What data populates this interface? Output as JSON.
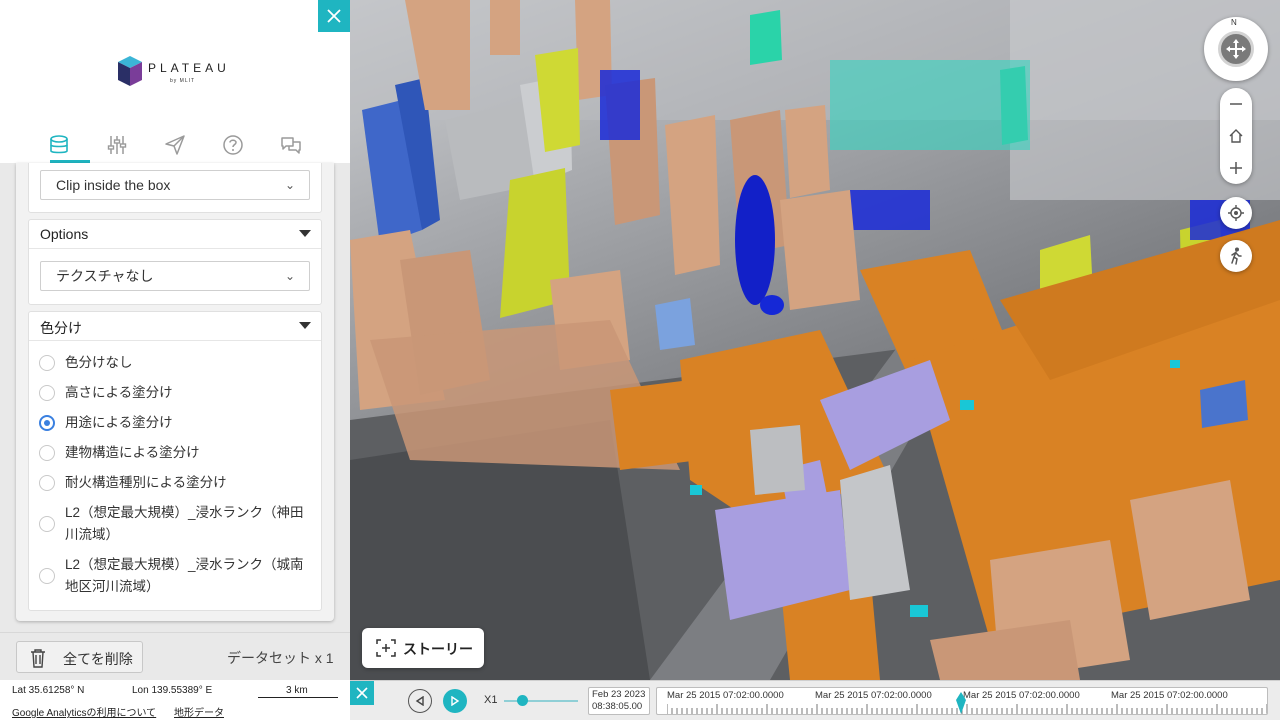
{
  "panel": {
    "logo_word": "PLATEAU",
    "logo_sub": "by MLIT",
    "tabs": [
      {
        "icon": "database-icon"
      },
      {
        "icon": "sliders-icon"
      },
      {
        "icon": "paper-plane-icon"
      },
      {
        "icon": "help-circle-icon"
      },
      {
        "icon": "chat-bubbles-icon"
      }
    ],
    "clip_select_value": "Clip inside the box",
    "options_title": "Options",
    "texture_select_value": "テクスチャなし",
    "color_title": "色分け",
    "color_options": [
      {
        "label": "色分けなし",
        "selected": false
      },
      {
        "label": "高さによる塗分け",
        "selected": false
      },
      {
        "label": "用途による塗分け",
        "selected": true
      },
      {
        "label": "建物構造による塗分け",
        "selected": false
      },
      {
        "label": "耐火構造種別による塗分け",
        "selected": false
      },
      {
        "label": "L2（想定最大規模）_浸水ランク（神田川流域）",
        "selected": false
      },
      {
        "label": "L2（想定最大規模）_浸水ランク（城南地区河川流域）",
        "selected": false
      }
    ],
    "delete_all_label": "全てを削除",
    "dataset_count": "データセット x 1"
  },
  "status": {
    "lat": "Lat  35.61258° N",
    "lon": "Lon  139.55389° E",
    "scale": "3 km",
    "analytics_link": "Google Analyticsの利用について",
    "terrain_link": "地形データ"
  },
  "controls": {
    "compass_north": "N"
  },
  "story_label": "ストーリー",
  "timeline": {
    "speed": "X1",
    "speed_fraction": 0.25,
    "current_date": "Feb 23 2023",
    "current_time": "08:38:05.00",
    "tick_labels": [
      "Mar 25 2015 07:02:00.0000",
      "Mar 25 2015 07:02:00.0000",
      "Mar 25 2015 07:02:00.0000",
      "Mar 25 2015 07:02:00.0000"
    ]
  },
  "colors": {
    "accent": "#1fb5c1",
    "radio_selected": "#3a80e0",
    "building_commercial": "#d98224",
    "building_office": "#d4a381",
    "building_public": "#4a74cc",
    "building_residential": "#cfd934",
    "building_station": "#a89ee0",
    "building_other": "#c4c6c9",
    "building_green": "#2ad3a9",
    "building_blue": "#1a2ad8"
  }
}
